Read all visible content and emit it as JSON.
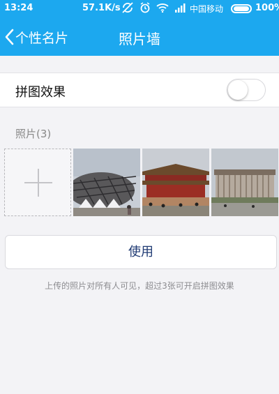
{
  "status_bar": {
    "time": "13:24",
    "speed": "57.1K/s",
    "carrier": "中国移动",
    "battery": "100%",
    "icons": [
      "sync-off-icon",
      "alarm-icon",
      "wifi-icon",
      "signal-icon",
      "battery-icon"
    ]
  },
  "nav": {
    "back_label": "个性名片",
    "title": "照片墙"
  },
  "toggle_row": {
    "label": "拼图效果",
    "enabled": false
  },
  "photos_section": {
    "label": "照片(3)",
    "photos": [
      {
        "name": "photo-birds-nest"
      },
      {
        "name": "photo-forbidden-city"
      },
      {
        "name": "photo-memorial-hall"
      }
    ]
  },
  "use_button": {
    "label": "使用"
  },
  "hint": "上传的照片对所有人可见，超过3张可开启拼图效果",
  "colors": {
    "header": "#1ca8ef",
    "background": "#f3f3f6",
    "button_text": "#1f3a73"
  }
}
